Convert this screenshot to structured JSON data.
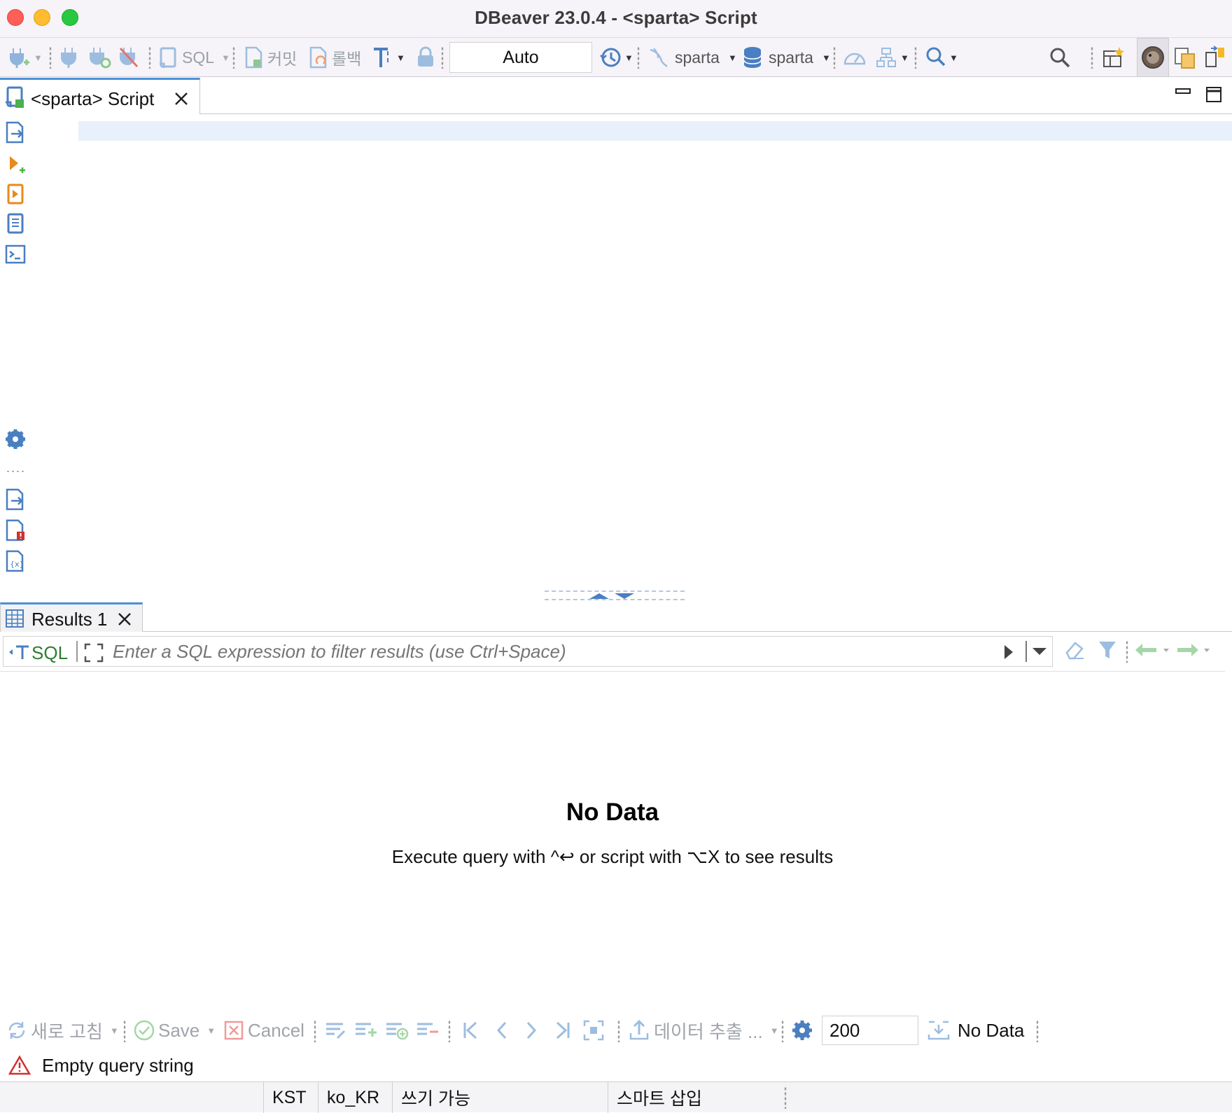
{
  "window": {
    "title": "DBeaver 23.0.4 - <sparta> Script"
  },
  "toolbar": {
    "sql_label": "SQL",
    "commit_label": "커밋",
    "rollback_label": "롤백",
    "transaction_mode": "Auto",
    "datasource_label": "sparta",
    "schema_label": "sparta"
  },
  "editor": {
    "tab_label": "<sparta> Script"
  },
  "results": {
    "tab_label": "Results 1",
    "filter_sql_label": "SQL",
    "filter_placeholder": "Enter a SQL expression to filter results (use Ctrl+Space)",
    "empty_title": "No Data",
    "empty_hint": "Execute query with ^↩ or script with ⌥X to see results",
    "toolbar": {
      "refresh_label": "새로 고침",
      "save_label": "Save",
      "cancel_label": "Cancel",
      "export_label": "데이터 추출 ...",
      "fetch_size": "200",
      "row_count_label": "No Data"
    },
    "message": "Empty query string"
  },
  "statusbar": {
    "timezone": "KST",
    "locale": "ko_KR",
    "write_mode": "쓰기 가능",
    "insert_mode": "스마트 삽입"
  },
  "colors": {
    "accent": "#4a90d9",
    "icon_blue": "#4a7fc1",
    "sql_green": "#2e7d32",
    "warning_red": "#d32f2f"
  }
}
